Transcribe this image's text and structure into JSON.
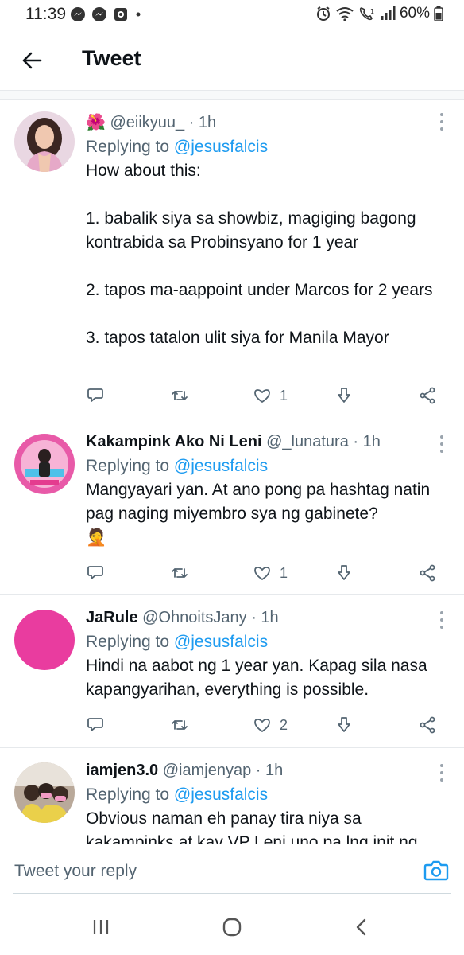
{
  "status_bar": {
    "time": "11:39",
    "battery": "60%",
    "icons": [
      "messenger-icon",
      "messenger-icon",
      "camera-app-icon",
      "dot-icon",
      "alarm-icon",
      "wifi-icon",
      "volte-call-icon",
      "signal-icon",
      "battery-icon"
    ]
  },
  "header": {
    "title": "Tweet"
  },
  "tweets": [
    {
      "emoji": "🌺",
      "name": "",
      "handle": "@eiikyuu_",
      "time": "· 1h",
      "replying_prefix": "Replying to ",
      "replying_to": "@jesusfalcis",
      "text": "How about this:\n\n1. babalik siya sa showbiz, magiging bagong kontrabida sa Probinsyano for 1 year\n\n2. tapos ma-aappoint under Marcos for 2 years\n\n3. tapos tatalon ulit siya for Manila Mayor",
      "likes": "1"
    },
    {
      "name": "Kakampink Ako Ni Leni",
      "handle": "@_lunatura",
      "time": "· 1h",
      "replying_prefix": "Replying to ",
      "replying_to": "@jesusfalcis",
      "text": "Mangyayari yan. At ano pong pa hashtag natin pag naging miyembro sya ng gabinete?",
      "text_emoji": "🤦",
      "likes": "1"
    },
    {
      "name": "JaRule",
      "handle": "@OhnoitsJany",
      "time": "· 1h",
      "replying_prefix": "Replying to ",
      "replying_to": "@jesusfalcis",
      "text": "Hindi na aabot ng 1 year yan. Kapag sila nasa kapangyarihan, everything is possible.",
      "likes": "2",
      "avatar_color": "#e93c9f"
    },
    {
      "name": "iamjen3.0",
      "handle": "@iamjenyap",
      "time": "· 1h",
      "replying_prefix": "Replying to ",
      "replying_to": "@jesusfalcis",
      "text": "Obvious naman eh panay tira niya sa kakampinks at kay VP Leni uno pa lng init ng"
    }
  ],
  "reply_bar": {
    "placeholder": "Tweet your reply"
  },
  "colors": {
    "accent": "#1d9bf0",
    "text": "#0f1419",
    "muted": "#536471"
  }
}
